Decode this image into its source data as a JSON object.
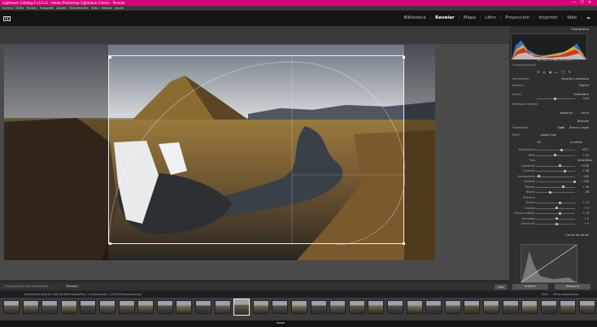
{
  "window": {
    "title": "Lightroom Catalog-2-v13-v1 - Adobe Photoshop Lightroom Classic - Revelar",
    "controls": [
      "—",
      "☐",
      "✕"
    ]
  },
  "menu": [
    "Archivo",
    "Editar",
    "Revelar",
    "Fotografía",
    "Ajustes",
    "Herramientas",
    "Vista",
    "Ventana",
    "Ayuda"
  ],
  "logo": "Lr",
  "modules": {
    "items": [
      "Biblioteca",
      "Revelar",
      "Mapa",
      "Libro",
      "Proyección",
      "Imprimir",
      "Web"
    ],
    "active": "Revelar",
    "separator": "|",
    "cloud_icon": "cloud-icon"
  },
  "toolbar": {
    "left_label": "Superposición de herramienta:",
    "overlay_value": "Siempre",
    "done_button": "Listo"
  },
  "right_panel": {
    "histogram_title": "Histograma",
    "histogram_readout": "ISO 100   21 mm   f/11   1/25",
    "original_label": "Fotografía original",
    "crop_section": {
      "label": "Herramienta",
      "title": "Recortar y enderezar",
      "aspect_label": "Aspecto:",
      "aspect_value": "Original",
      "angle_label": "Ángulo",
      "auto": "Automático",
      "angle_value": "0,00",
      "constrain": "Restringir a imagen",
      "reset": "Restaurar",
      "close": "Cerrar"
    },
    "basic": {
      "title": "Básicos",
      "treatment_label": "Tratamiento:",
      "color": "Color",
      "bw": "Blanco y negro",
      "profile_label": "Perfil:",
      "profile_value": "Adobe Color",
      "wb_label": "WB:",
      "wb_value": "A medida",
      "rows": [
        {
          "label": "Temperatura",
          "value": "4577"
        },
        {
          "label": "Matiz",
          "value": "+ 10"
        },
        {
          "label": "Tono",
          "value": "Automático"
        },
        {
          "label": "Exposición",
          "value": "+ 0,36"
        },
        {
          "label": "Contraste",
          "value": "+ 38"
        },
        {
          "label": "Iluminaciones",
          "value": "- 100"
        },
        {
          "label": "Sombras",
          "value": "+ 100"
        },
        {
          "label": "Blancos",
          "value": "+ 36"
        },
        {
          "label": "Negros",
          "value": "- 38"
        },
        {
          "label": "Presencia",
          "value": ""
        },
        {
          "label": "Textura",
          "value": "+ 13"
        },
        {
          "label": "Claridad",
          "value": "+ 0"
        },
        {
          "label": "Eliminar neblina",
          "value": "+ 13"
        },
        {
          "label": "Intensidad",
          "value": "+ 0"
        },
        {
          "label": "Saturación",
          "value": "+ 0"
        }
      ]
    },
    "curve_title": "Curva de tonos",
    "previous_button": "Anterior",
    "reset_button": "Restaurar"
  },
  "filmstrip": {
    "info": "Importación anterior   2562 de 2659 fotografías / 1 seleccionada /   _VIC5279-Panorama.dng",
    "filter_label": "Filtro:",
    "filter_value": "Filtros desactivados",
    "thumb_count": 31,
    "selected_index": 12
  }
}
